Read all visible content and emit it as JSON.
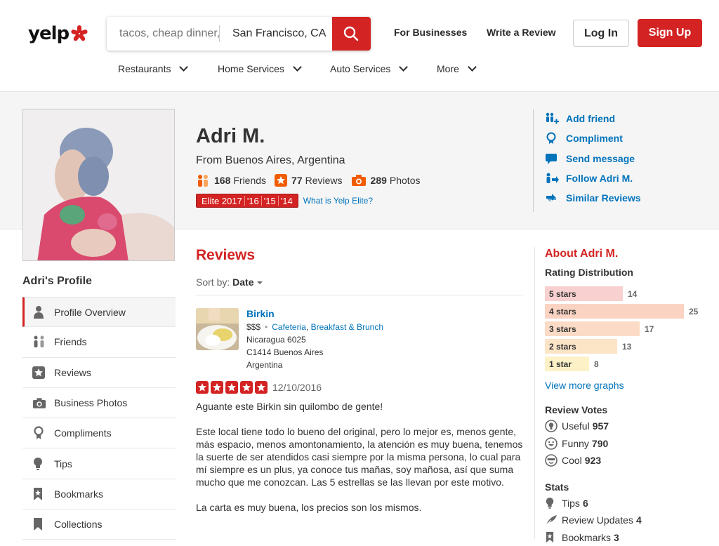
{
  "header": {
    "logo": "yelp",
    "search_find_placeholder": "tacos, cheap dinner, Max's",
    "search_near_value": "San Francisco, CA",
    "for_businesses": "For Businesses",
    "write_review": "Write a Review",
    "login": "Log In",
    "signup": "Sign Up",
    "categories": [
      {
        "label": "Restaurants"
      },
      {
        "label": "Home Services"
      },
      {
        "label": "Auto Services"
      },
      {
        "label": "More"
      }
    ]
  },
  "profile": {
    "name": "Adri M.",
    "location": "From Buenos Aires, Argentina",
    "friends_count": "168",
    "friends_label": "Friends",
    "reviews_count": "77",
    "reviews_label": "Reviews",
    "photos_count": "289",
    "photos_label": "Photos",
    "elite_label": "Elite 2017",
    "elite_years": [
      "'16",
      "'15",
      "'14"
    ],
    "elite_link": "What is Yelp Elite?"
  },
  "actions": [
    {
      "label": "Add friend",
      "icon": "add-friend-icon"
    },
    {
      "label": "Compliment",
      "icon": "compliment-icon"
    },
    {
      "label": "Send message",
      "icon": "message-icon"
    },
    {
      "label": "Follow Adri M.",
      "icon": "follow-icon"
    },
    {
      "label": "Similar Reviews",
      "icon": "similar-icon"
    }
  ],
  "sidebar": {
    "title": "Adri's Profile",
    "items": [
      {
        "label": "Profile Overview",
        "icon": "person-icon"
      },
      {
        "label": "Friends",
        "icon": "friends-icon"
      },
      {
        "label": "Reviews",
        "icon": "star-icon"
      },
      {
        "label": "Business Photos",
        "icon": "camera-icon"
      },
      {
        "label": "Compliments",
        "icon": "compliment-icon"
      },
      {
        "label": "Tips",
        "icon": "lightbulb-icon"
      },
      {
        "label": "Bookmarks",
        "icon": "bookmark-icon"
      },
      {
        "label": "Collections",
        "icon": "collections-icon"
      }
    ]
  },
  "reviews": {
    "title": "Reviews",
    "sort_label": "Sort by:",
    "sort_value": "Date",
    "items": [
      {
        "business": "Birkin",
        "price": "$$$",
        "categories": [
          "Cafeteria",
          "Breakfast & Brunch"
        ],
        "address_line1": "Nicaragua 6025",
        "address_line2": "C1414 Buenos Aires",
        "address_line3": "Argentina",
        "rating": 5,
        "date": "12/10/2016",
        "paragraphs": [
          "Aguante este Birkin sin quilombo de gente!",
          "Este local tiene todo lo bueno del original, pero lo mejor es, menos gente, más espacio, menos amontonamiento, la atención es muy buena, tenemos la suerte de ser atendidos casi siempre por la misma persona, lo cual para mí siempre es un plus, ya conoce tus mañas, soy mañosa, así que suma mucho que me conozcan. Las 5 estrellas se las llevan por este motivo.",
          "La carta es muy buena, los precios son los mismos."
        ]
      }
    ]
  },
  "about": {
    "title": "About Adri M.",
    "rating_distribution_title": "Rating Distribution",
    "distribution": [
      {
        "label": "5 stars",
        "count": 14,
        "color": "#f8d0cf"
      },
      {
        "label": "4 stars",
        "count": 25,
        "color": "#fbd3c2"
      },
      {
        "label": "3 stars",
        "count": 17,
        "color": "#fbdbc5"
      },
      {
        "label": "2 stars",
        "count": 13,
        "color": "#fce4c7"
      },
      {
        "label": "1 star",
        "count": 8,
        "color": "#fdf1c7"
      }
    ],
    "more_graphs": "View more graphs",
    "review_votes_title": "Review Votes",
    "votes": [
      {
        "label": "Useful",
        "count": "957",
        "icon": "useful-icon"
      },
      {
        "label": "Funny",
        "count": "790",
        "icon": "funny-icon"
      },
      {
        "label": "Cool",
        "count": "923",
        "icon": "cool-icon"
      }
    ],
    "stats_title": "Stats",
    "stats": [
      {
        "label": "Tips",
        "count": "6",
        "icon": "lightbulb-icon"
      },
      {
        "label": "Review Updates",
        "count": "4",
        "icon": "feather-icon"
      },
      {
        "label": "Bookmarks",
        "count": "3",
        "icon": "bookmark-icon"
      }
    ]
  },
  "colors": {
    "brand_red": "#d32323",
    "link_blue": "#0073bb",
    "band_bg": "#f5f5f5"
  }
}
